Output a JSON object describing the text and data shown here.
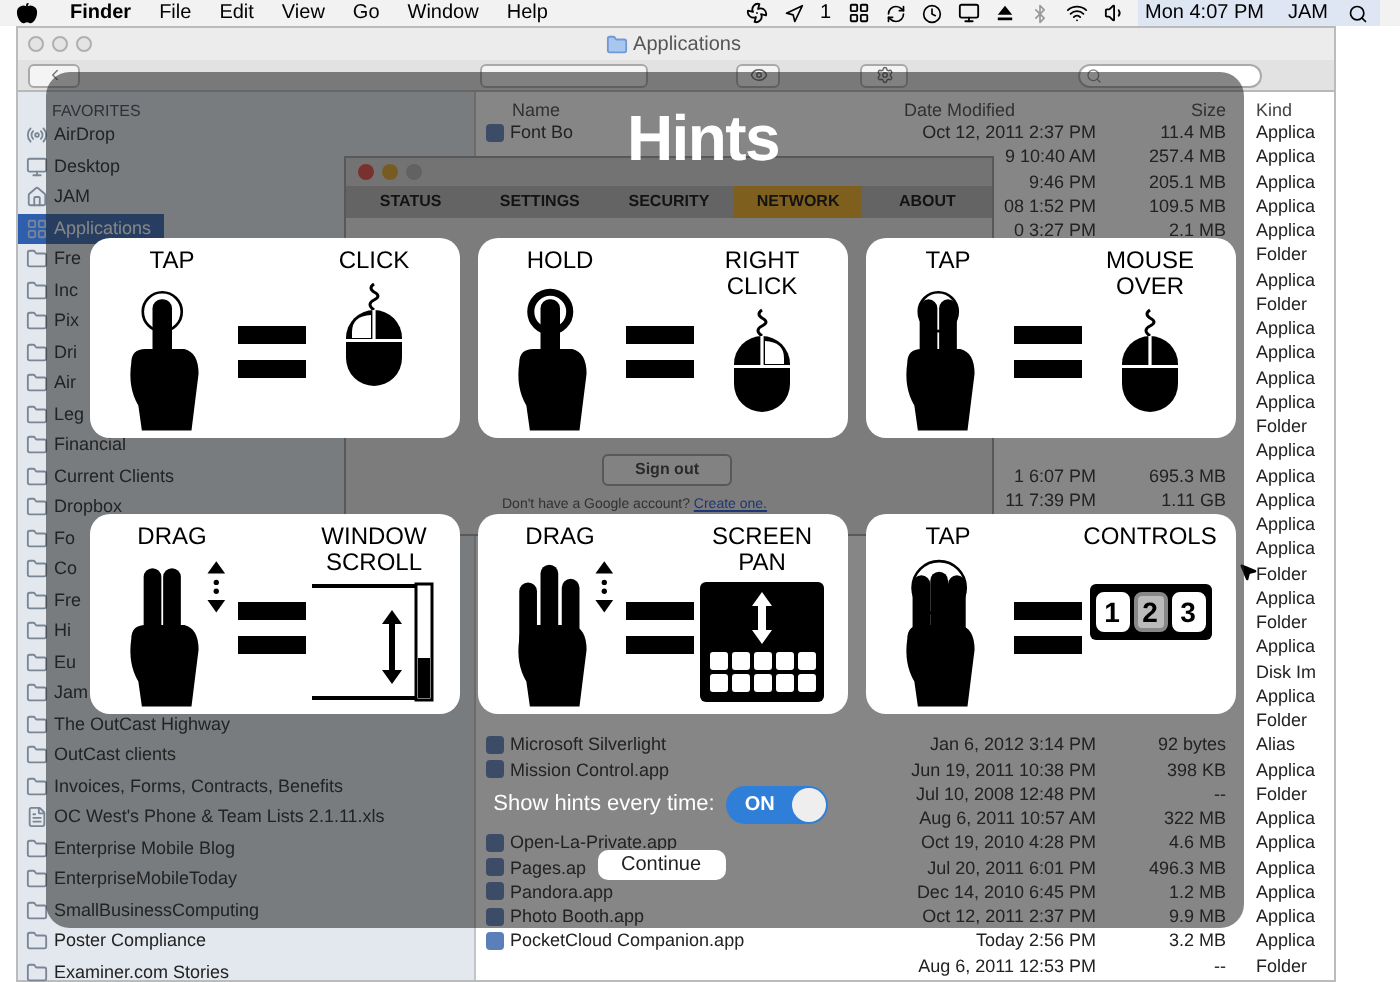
{
  "menu_bar": {
    "app": "Finder",
    "menus": [
      "File",
      "Edit",
      "View",
      "Go",
      "Window",
      "Help"
    ],
    "badge": "1",
    "clock": "Mon 4:07 PM",
    "user": "JAM"
  },
  "finder": {
    "title": "Applications",
    "sidebar": {
      "heading": "FAVORITES",
      "items": [
        {
          "label": "AirDrop",
          "kind": "airdrop",
          "selected": false
        },
        {
          "label": "Desktop",
          "kind": "desktop",
          "selected": false
        },
        {
          "label": "JAM",
          "kind": "home",
          "selected": false
        },
        {
          "label": "Applications",
          "kind": "applications",
          "selected": true
        },
        {
          "label": "Fre",
          "kind": "folder",
          "selected": false
        },
        {
          "label": "Inc",
          "kind": "folder",
          "selected": false
        },
        {
          "label": "Pix",
          "kind": "folder",
          "selected": false
        },
        {
          "label": "Dri",
          "kind": "folder",
          "selected": false
        },
        {
          "label": "Air",
          "kind": "folder",
          "selected": false
        },
        {
          "label": "Leg",
          "kind": "folder",
          "selected": false
        },
        {
          "label": "Financial",
          "kind": "folder",
          "selected": false
        },
        {
          "label": "Current Clients",
          "kind": "folder",
          "selected": false
        },
        {
          "label": "Dropbox",
          "kind": "folder",
          "selected": false
        },
        {
          "label": "Fo",
          "kind": "folder",
          "selected": false
        },
        {
          "label": "Co",
          "kind": "folder",
          "selected": false
        },
        {
          "label": "Fre",
          "kind": "folder",
          "selected": false
        },
        {
          "label": "Hi",
          "kind": "folder",
          "selected": false
        },
        {
          "label": "Eu",
          "kind": "folder",
          "selected": false
        },
        {
          "label": "Jam",
          "kind": "folder",
          "selected": false
        },
        {
          "label": "The OutCast Highway",
          "kind": "folder",
          "selected": false
        },
        {
          "label": "OutCast clients",
          "kind": "folder",
          "selected": false
        },
        {
          "label": "Invoices, Forms, Contracts, Benefits",
          "kind": "folder",
          "selected": false
        },
        {
          "label": "OC West's Phone & Team Lists 2.1.11.xls",
          "kind": "document",
          "selected": false
        },
        {
          "label": "Enterprise Mobile Blog",
          "kind": "folder",
          "selected": false
        },
        {
          "label": "EnterpriseMobileToday",
          "kind": "folder",
          "selected": false
        },
        {
          "label": "SmallBusinessComputing",
          "kind": "folder",
          "selected": false
        },
        {
          "label": "Poster Compliance",
          "kind": "folder",
          "selected": false
        },
        {
          "label": "Examiner.com Stories",
          "kind": "folder",
          "selected": false
        }
      ]
    },
    "columns": [
      "Name",
      "Date Modified",
      "Size",
      "Kind"
    ],
    "rows": [
      {
        "name": "Font Bo",
        "date": "Oct 12, 2011 2:37 PM",
        "size": "11.4 MB",
        "file_kind": "Applica"
      },
      {
        "date": "9 10:40 AM",
        "size": "257.4 MB",
        "file_kind": "Applica"
      },
      {
        "date": "9:46 PM",
        "size": "205.1 MB",
        "file_kind": "Applica"
      },
      {
        "date": "08 1:52 PM",
        "size": "109.5 MB",
        "file_kind": "Applica"
      },
      {
        "date": "0 3:27 PM",
        "size": "2.1 MB",
        "file_kind": "Applica"
      },
      {
        "file_kind": "Folder"
      },
      {
        "file_kind": "Applica"
      },
      {
        "file_kind": "Folder"
      },
      {
        "file_kind": "Applica"
      },
      {
        "file_kind": "Applica"
      },
      {
        "file_kind": "Applica"
      },
      {
        "file_kind": "Applica"
      },
      {
        "file_kind": "Folder"
      },
      {
        "file_kind": "Applica"
      },
      {
        "date": "1 6:07 PM",
        "size": "695.3 MB",
        "file_kind": "Applica"
      },
      {
        "date": "11 7:39 PM",
        "size": "1.11 GB",
        "file_kind": "Applica"
      },
      {
        "file_kind": "Applica"
      },
      {
        "file_kind": "Applica"
      },
      {
        "file_kind": "Folder"
      },
      {
        "file_kind": "Applica"
      },
      {
        "file_kind": "Folder"
      },
      {
        "file_kind": "Applica"
      },
      {
        "file_kind": "Disk Im"
      },
      {
        "file_kind": "Applica"
      },
      {
        "file_kind": "Folder"
      },
      {
        "name": "Microsoft Silverlight",
        "date": "Jan 6, 2012 3:14 PM",
        "size": "92 bytes",
        "file_kind": "Alias"
      },
      {
        "name": "Mission Control.app",
        "date": "Jun 19, 2011 10:38 PM",
        "size": "398 KB",
        "file_kind": "Applica"
      },
      {
        "date": "Jul 10, 2008 12:48 PM",
        "size": "--",
        "file_kind": "Folder"
      },
      {
        "date": "Aug 6, 2011 10:57 AM",
        "size": "322 MB",
        "file_kind": "Applica"
      },
      {
        "name": "Open-La-Private.app",
        "date": "Oct 19, 2010 4:28 PM",
        "size": "4.6 MB",
        "file_kind": "Applica"
      },
      {
        "name": "Pages.ap",
        "date": "Jul 20, 2011 6:01 PM",
        "size": "496.3 MB",
        "file_kind": "Applica"
      },
      {
        "name": "Pandora.app",
        "date": "Dec 14, 2010 6:45 PM",
        "size": "1.2 MB",
        "file_kind": "Applica"
      },
      {
        "name": "Photo Booth.app",
        "date": "Oct 12, 2011 2:37 PM",
        "size": "9.9 MB",
        "file_kind": "Applica"
      },
      {
        "name": "PocketCloud Companion.app",
        "date": "Today 2:56 PM",
        "size": "3.2 MB",
        "file_kind": "Applica"
      },
      {
        "date": "Aug 6, 2011 12:53 PM",
        "size": "--",
        "file_kind": "Folder"
      }
    ]
  },
  "app_dialog": {
    "tabs": [
      {
        "label": "STATUS",
        "selected": false
      },
      {
        "label": "SETTINGS",
        "selected": false
      },
      {
        "label": "SECURITY",
        "selected": false
      },
      {
        "label": "NETWORK",
        "selected": true
      },
      {
        "label": "ABOUT",
        "selected": false
      }
    ],
    "button": "Sign out",
    "prompt": "Don't have a Google account?",
    "link": "Create one."
  },
  "hints": {
    "title": "Hints",
    "cards": [
      {
        "gesture": "TAP",
        "result": "CLICK",
        "hand": {
          "kind": "one-finger-tap"
        },
        "target": {
          "kind": "mouse-left"
        }
      },
      {
        "gesture": "HOLD",
        "result": "RIGHT CLICK",
        "hand": {
          "kind": "one-finger-hold"
        },
        "target": {
          "kind": "mouse-right"
        }
      },
      {
        "gesture": "TAP",
        "result": "MOUSE OVER",
        "hand": {
          "kind": "two-finger-tap"
        },
        "target": {
          "kind": "mouse-plain"
        }
      },
      {
        "gesture": "DRAG",
        "result": "WINDOW SCROLL",
        "hand": {
          "kind": "two-finger-drag"
        },
        "target": {
          "kind": "window-scroll"
        }
      },
      {
        "gesture": "DRAG",
        "result": "SCREEN PAN",
        "hand": {
          "kind": "three-finger-drag"
        },
        "target": {
          "kind": "screen-pan"
        }
      },
      {
        "gesture": "TAP",
        "result": "CONTROLS",
        "hand": {
          "kind": "three-finger-tap"
        },
        "target": {
          "kind": "number-keys"
        },
        "digits": [
          {
            "text": "1",
            "selected": false
          },
          {
            "text": "2",
            "selected": true
          },
          {
            "text": "3",
            "selected": false
          }
        ]
      }
    ],
    "toggle": {
      "label": "Show hints every time:",
      "on": true,
      "text": "ON"
    },
    "button": "Continue"
  }
}
